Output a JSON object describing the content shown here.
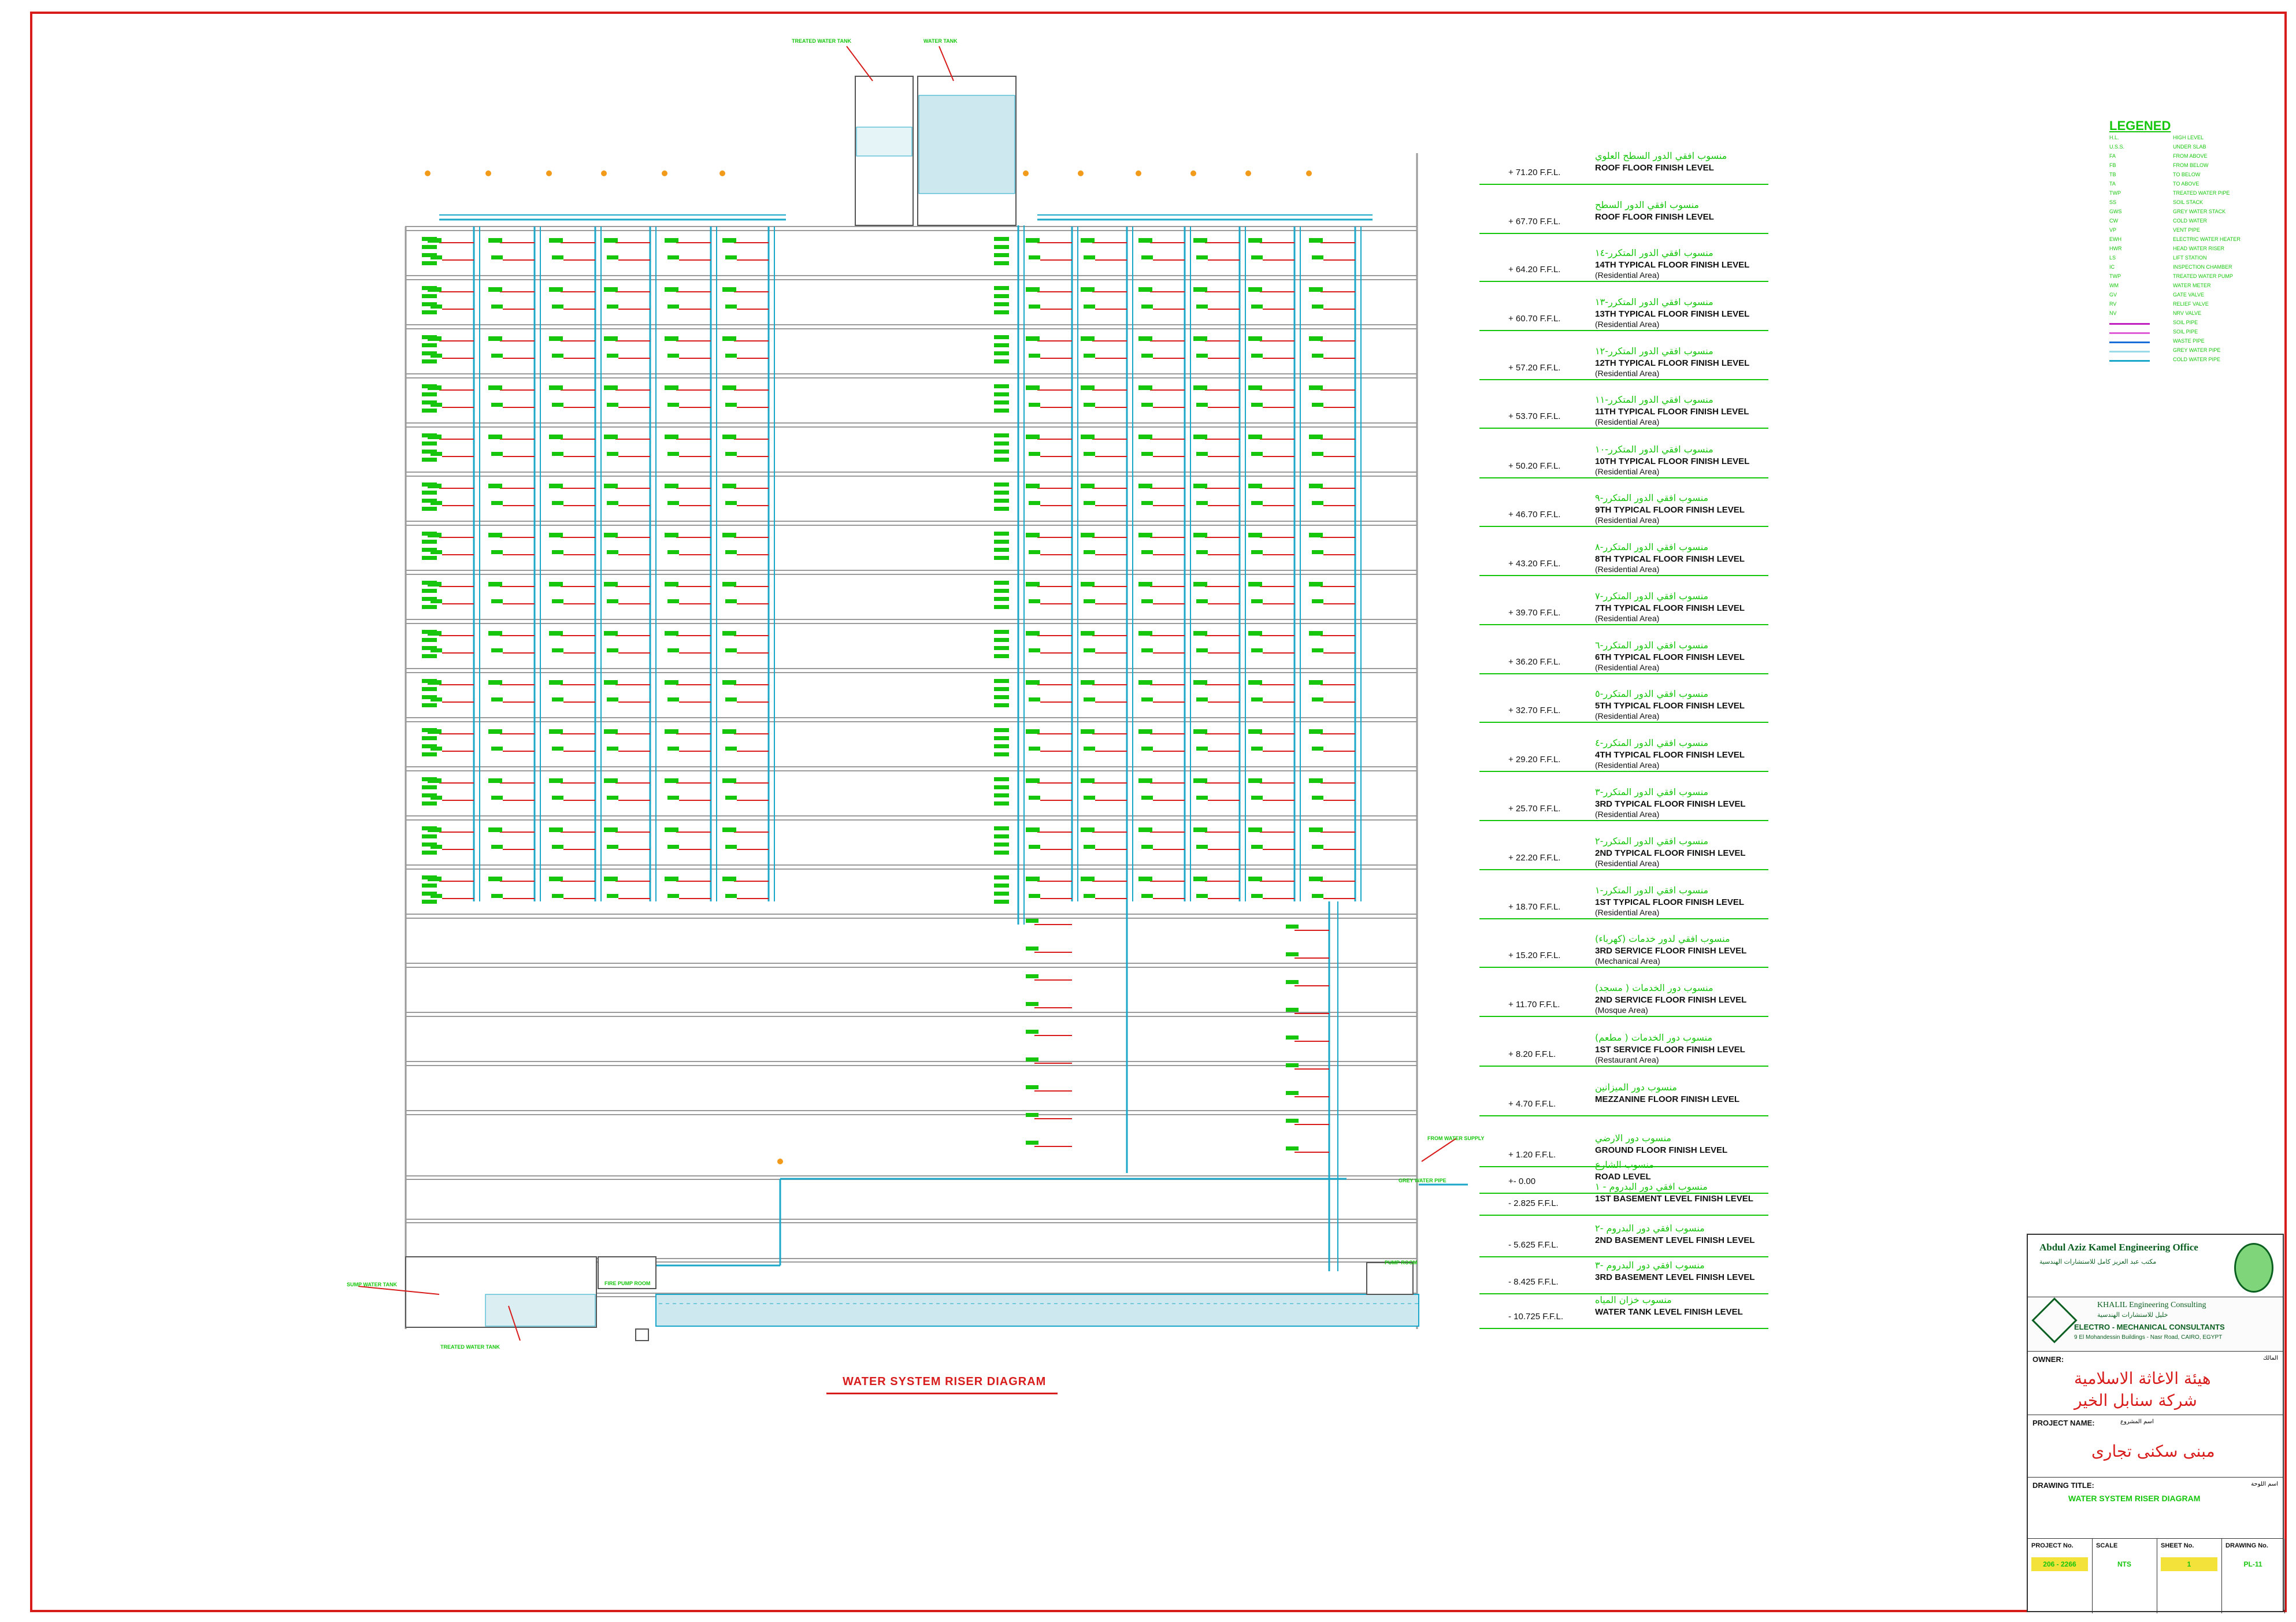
{
  "drawing_title": "WATER SYSTEM RISER DIAGRAM",
  "colors": {
    "border": "#d81b1b",
    "text_green": "#16c60c",
    "hot": "#d81b1b",
    "cold": "#1aa7c9",
    "slab": "#9a9a9a",
    "soil": "#c020c0"
  },
  "top_tanks": {
    "left": "TREATED WATER TANK",
    "right": "WATER TANK"
  },
  "basement_labels": {
    "sump": "SUMP WATER TANK",
    "treated": "TREATED WATER TANK",
    "fire_pump": "FIRE PUMP ROOM",
    "pump_room": "PUMP ROOM",
    "water_supply": "FROM WATER SUPPLY",
    "grey": "GREY WATER PIPE"
  },
  "levels": [
    {
      "ar": "منسوب افقي الدور السطح العلوي",
      "en": "ROOF FLOOR FINISH LEVEL",
      "sub": "",
      "el": "+ 71.20 F.F.L."
    },
    {
      "ar": "منسوب افقي الدور السطح",
      "en": "ROOF FLOOR FINISH LEVEL",
      "sub": "",
      "el": "+ 67.70 F.F.L."
    },
    {
      "ar": "منسوب افقي الدور المتكرر-١٤",
      "en": "14TH TYPICAL FLOOR FINISH LEVEL",
      "sub": "(Residential Area)",
      "el": "+ 64.20 F.F.L."
    },
    {
      "ar": "منسوب افقي الدور المتكرر-١٣",
      "en": "13TH TYPICAL FLOOR FINISH LEVEL",
      "sub": "(Residential Area)",
      "el": "+ 60.70 F.F.L."
    },
    {
      "ar": "منسوب افقي الدور المتكرر-١٢",
      "en": "12TH TYPICAL FLOOR FINISH LEVEL",
      "sub": "(Residential Area)",
      "el": "+ 57.20 F.F.L."
    },
    {
      "ar": "منسوب افقي الدور المتكرر-١١",
      "en": "11TH TYPICAL FLOOR FINISH LEVEL",
      "sub": "(Residential Area)",
      "el": "+ 53.70 F.F.L."
    },
    {
      "ar": "منسوب افقي الدور المتكرر-١٠",
      "en": "10TH TYPICAL FLOOR FINISH LEVEL",
      "sub": "(Residential Area)",
      "el": "+ 50.20 F.F.L."
    },
    {
      "ar": "منسوب افقي الدور المتكرر-٩",
      "en": "9TH TYPICAL FLOOR FINISH LEVEL",
      "sub": "(Residential Area)",
      "el": "+ 46.70 F.F.L."
    },
    {
      "ar": "منسوب افقي الدور المتكرر-٨",
      "en": "8TH TYPICAL FLOOR FINISH LEVEL",
      "sub": "(Residential Area)",
      "el": "+ 43.20 F.F.L."
    },
    {
      "ar": "منسوب افقي الدور المتكرر-٧",
      "en": "7TH TYPICAL FLOOR FINISH LEVEL",
      "sub": "(Residential Area)",
      "el": "+ 39.70 F.F.L."
    },
    {
      "ar": "منسوب افقي الدور المتكرر-٦",
      "en": "6TH TYPICAL FLOOR FINISH LEVEL",
      "sub": "(Residential Area)",
      "el": "+ 36.20 F.F.L."
    },
    {
      "ar": "منسوب افقي الدور المتكرر-٥",
      "en": "5TH TYPICAL FLOOR FINISH LEVEL",
      "sub": "(Residential Area)",
      "el": "+ 32.70 F.F.L."
    },
    {
      "ar": "منسوب افقي الدور المتكرر-٤",
      "en": "4TH TYPICAL FLOOR FINISH LEVEL",
      "sub": "(Residential Area)",
      "el": "+ 29.20 F.F.L."
    },
    {
      "ar": "منسوب افقي الدور المتكرر-٣",
      "en": "3RD TYPICAL FLOOR FINISH LEVEL",
      "sub": "(Residential Area)",
      "el": "+ 25.70 F.F.L."
    },
    {
      "ar": "منسوب افقي الدور المتكرر-٢",
      "en": "2ND TYPICAL FLOOR FINISH LEVEL",
      "sub": "(Residential Area)",
      "el": "+ 22.20 F.F.L."
    },
    {
      "ar": "منسوب افقي الدور المتكرر-١",
      "en": "1ST TYPICAL FLOOR FINISH LEVEL",
      "sub": "(Residential Area)",
      "el": "+ 18.70 F.F.L."
    },
    {
      "ar": "منسوب افقي لدور خدمات (كهرباء)",
      "en": "3RD SERVICE FLOOR FINISH LEVEL",
      "sub": "(Mechanical Area)",
      "el": "+ 15.20 F.F.L."
    },
    {
      "ar": "منسوب دور الخدمات ( مسجد)",
      "en": "2ND SERVICE FLOOR FINISH LEVEL",
      "sub": "(Mosque Area)",
      "el": "+ 11.70 F.F.L."
    },
    {
      "ar": "منسوب دور الخدمات ( مطعم)",
      "en": "1ST SERVICE FLOOR FINISH LEVEL",
      "sub": "(Restaurant Area)",
      "el": "+ 8.20 F.F.L."
    },
    {
      "ar": "منسوب دور الميزانين",
      "en": "MEZZANINE FLOOR FINISH LEVEL",
      "sub": "",
      "el": "+ 4.70 F.F.L."
    },
    {
      "ar": "منسوب دور الارضي",
      "en": "GROUND FLOOR FINISH LEVEL",
      "sub": "",
      "el": "+ 1.20 F.F.L."
    },
    {
      "ar": "منسوب الشارع",
      "en": "ROAD LEVEL",
      "sub": "",
      "el": "+- 0.00"
    },
    {
      "ar": "منسوب افقي دور البدروم - ١",
      "en": "1ST BASEMENT LEVEL FINISH LEVEL",
      "sub": "",
      "el": "- 2.825 F.F.L."
    },
    {
      "ar": "منسوب افقي دور البدروم -٢",
      "en": "2ND BASEMENT LEVEL FINISH LEVEL",
      "sub": "",
      "el": "- 5.625 F.F.L."
    },
    {
      "ar": "منسوب افقي دور البدروم -٣",
      "en": "3RD BASEMENT LEVEL FINISH LEVEL",
      "sub": "",
      "el": "- 8.425 F.F.L."
    },
    {
      "ar": "منسوب خزان المياه",
      "en": "WATER TANK LEVEL FINISH LEVEL",
      "sub": "",
      "el": "- 10.725 F.F.L."
    }
  ],
  "legend": {
    "title": "LEGENED",
    "rows": [
      {
        "ab": "H.L.",
        "ds": "HIGH LEVEL"
      },
      {
        "ab": "U.S.S.",
        "ds": "UNDER SLAB"
      },
      {
        "ab": "FA",
        "ds": "FROM ABOVE"
      },
      {
        "ab": "FB",
        "ds": "FROM BELOW"
      },
      {
        "ab": "TB",
        "ds": "TO BELOW"
      },
      {
        "ab": "TA",
        "ds": "TO ABOVE"
      },
      {
        "ab": "TWP",
        "ds": "TREATED WATER PIPE"
      },
      {
        "ab": "SS",
        "ds": "SOIL STACK"
      },
      {
        "ab": "GWS",
        "ds": "GREY WATER STACK"
      },
      {
        "ab": "CW",
        "ds": "COLD WATER"
      },
      {
        "ab": "VP",
        "ds": "VENT PIPE"
      },
      {
        "ab": "EWH",
        "ds": "ELECTRIC WATER HEATER"
      },
      {
        "ab": "HWR",
        "ds": "HEAD WATER RISER"
      },
      {
        "ab": "LS",
        "ds": "LIFT STATION"
      },
      {
        "ab": "IC",
        "ds": "INSPECTION CHAMBER"
      },
      {
        "ab": "TWP",
        "ds": "TREATED WATER PUMP"
      },
      {
        "ab": "WM",
        "ds": "WATER METER"
      },
      {
        "ab": "GV",
        "ds": "GATE VALVE"
      },
      {
        "ab": "RV",
        "ds": "RELIEF VALVE"
      },
      {
        "ab": "NV",
        "ds": "NRV VALVE"
      }
    ],
    "lines": [
      {
        "ds": "SOIL PIPE",
        "color": "#c020c0"
      },
      {
        "ds": "SOIL PIPE",
        "color": "#e05ad6"
      },
      {
        "ds": "WASTE PIPE",
        "color": "#1a6ed8"
      },
      {
        "ds": "GREY WATER PIPE",
        "color": "#9ad9ea"
      },
      {
        "ds": "COLD WATER PIPE",
        "color": "#1aa7c9"
      }
    ]
  },
  "title_block": {
    "office": "Abdul Aziz Kamel Engineering Office",
    "office_ar": "مكتب عبد العزيز كامل للاستشارات الهندسية",
    "consultant": "KHALIL Engineering Consulting",
    "consultant_ar": "خليل للاستشارات الهندسية",
    "consultant_sub": "ELECTRO - MECHANICAL CONSULTANTS",
    "address": "9 El Mohandessin Buildings - Nasr Road, CAIRO, EGYPT",
    "owner_label": "OWNER:",
    "owner_label_ar": "المالك",
    "owner_ar_1": "هيئة الاغاثة الاسلامية",
    "owner_ar_2": "شركة سنابل الخير",
    "project_label": "PROJECT NAME:",
    "project_label_ar": "اسم المشروع",
    "project_ar": "مبنى سكنى تجارى",
    "drawing_label": "DRAWING   TITLE:",
    "drawing_label_ar": "اسم اللوحة",
    "drawing_title": "WATER SYSTEM RISER DIAGRAM",
    "fields": [
      {
        "label": "PROJECT No.",
        "value": "206 - 2266"
      },
      {
        "label": "SCALE",
        "value": "NTS"
      },
      {
        "label": "SHEET No.",
        "value": "1"
      },
      {
        "label": "DRAWING No.",
        "value": "PL-11"
      }
    ]
  }
}
